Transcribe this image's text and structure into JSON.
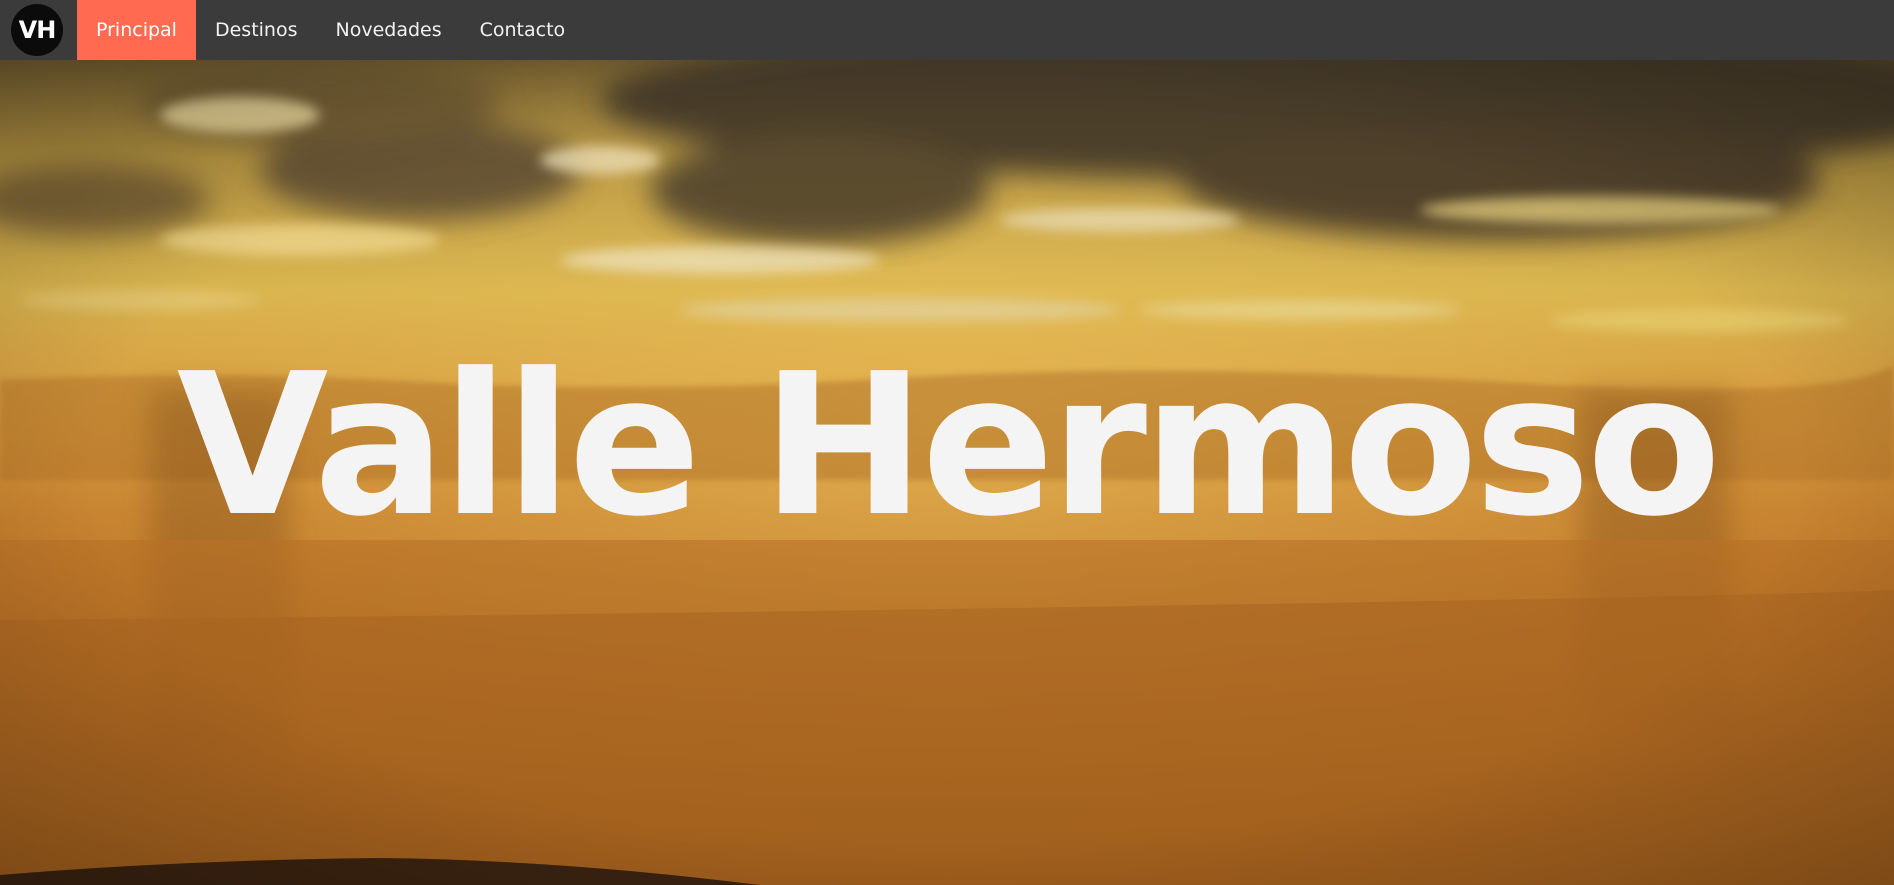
{
  "nav": {
    "logo": {
      "text": "VH",
      "icon": "vh-logo"
    },
    "links": [
      {
        "label": "Principal",
        "active": true
      },
      {
        "label": "Destinos",
        "active": false
      },
      {
        "label": "Novedades",
        "active": false
      },
      {
        "label": "Contacto",
        "active": false
      }
    ]
  },
  "hero": {
    "title": "Valle Hermoso",
    "background": "sunset-landscape-image"
  },
  "colors": {
    "navbar_bg": "#3b3b3b",
    "active_link_bg": "#ff6a50",
    "logo_bg": "#0b0b0b",
    "title_text": "#f5f4f4"
  }
}
